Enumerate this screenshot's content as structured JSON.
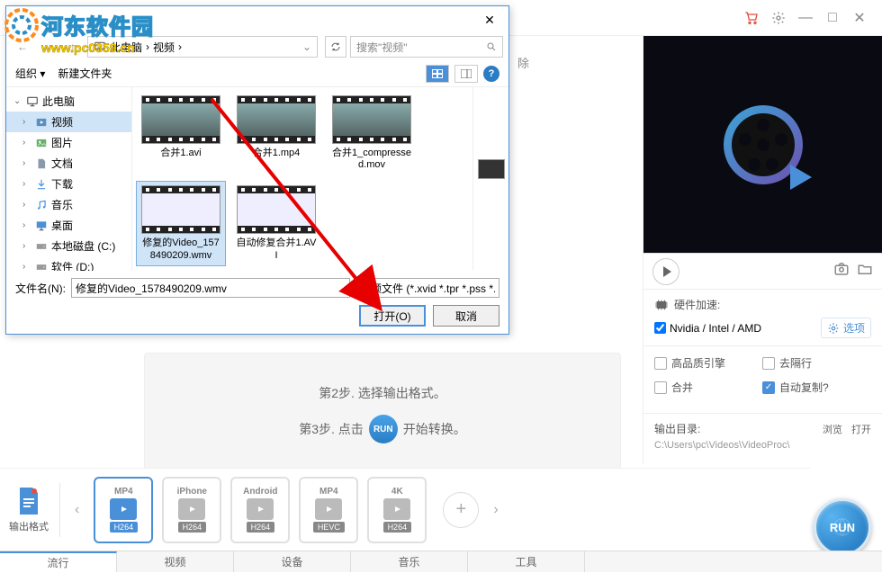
{
  "watermark": {
    "title": "河东软件园",
    "url": "www.pc0359.cn"
  },
  "titlebar": {
    "minimize": "—",
    "maximize": "□",
    "close": "✕"
  },
  "clear_label": "除",
  "steps": {
    "step2": "第2步. 选择输出格式。",
    "step3_a": "第3步. 点击",
    "step3_run": "RUN",
    "step3_b": "开始转换。"
  },
  "dialog": {
    "close": "✕",
    "back": "←",
    "fwd": "→",
    "up": "↑",
    "path_root": "此电脑",
    "path_sep": "›",
    "path_cur": "视频",
    "search_placeholder": "搜索\"视频\"",
    "organize": "组织 ▾",
    "newfolder": "新建文件夹",
    "tree": [
      {
        "label": "此电脑",
        "icon": "pc",
        "root": true
      },
      {
        "label": "视频",
        "icon": "video",
        "selected": true
      },
      {
        "label": "图片",
        "icon": "image"
      },
      {
        "label": "文档",
        "icon": "doc"
      },
      {
        "label": "下载",
        "icon": "download"
      },
      {
        "label": "音乐",
        "icon": "music"
      },
      {
        "label": "桌面",
        "icon": "desktop"
      },
      {
        "label": "本地磁盘 (C:)",
        "icon": "disk"
      },
      {
        "label": "软件 (D:)",
        "icon": "disk"
      }
    ],
    "files": [
      {
        "name": "合并1.avi",
        "selected": false,
        "inner": "dark"
      },
      {
        "name": "合并1.mp4",
        "selected": false,
        "inner": "dark"
      },
      {
        "name": "合并1_compressed.mov",
        "selected": false,
        "inner": "dark"
      },
      {
        "name": "修复的Video_1578490209.wmv",
        "selected": true,
        "inner": "ui"
      },
      {
        "name": "自动修复合并1.AVI",
        "selected": false,
        "inner": "ui"
      }
    ],
    "filename_label": "文件名(N):",
    "filename_value": "修复的Video_1578490209.wmv",
    "filetype_value": "视频文件 (*.xvid *.tpr *.pss *.",
    "open_btn": "打开(O)",
    "cancel_btn": "取消"
  },
  "right": {
    "hw_label": "硬件加速:",
    "hw_value": "Nvidia / Intel / AMD",
    "opts_label": "选项",
    "checks": {
      "hq": "高品质引擎",
      "deint": "去隔行",
      "merge": "合并",
      "autocopy": "自动复制?"
    },
    "outdir_label": "输出目录:",
    "browse": "浏览",
    "open": "打开",
    "outdir_path": "C:\\Users\\pc\\Videos\\VideoProc\\"
  },
  "formats": {
    "title": "输出格式",
    "items": [
      {
        "top": "MP4",
        "codec": "H264",
        "active": true
      },
      {
        "top": "iPhone",
        "codec": "H264",
        "active": false
      },
      {
        "top": "Android",
        "codec": "H264",
        "active": false
      },
      {
        "top": "MP4",
        "codec": "HEVC",
        "active": false
      },
      {
        "top": "4K",
        "codec": "H264",
        "active": false
      }
    ]
  },
  "run_label": "RUN",
  "tabs": [
    "流行",
    "视频",
    "设备",
    "音乐",
    "工具"
  ]
}
